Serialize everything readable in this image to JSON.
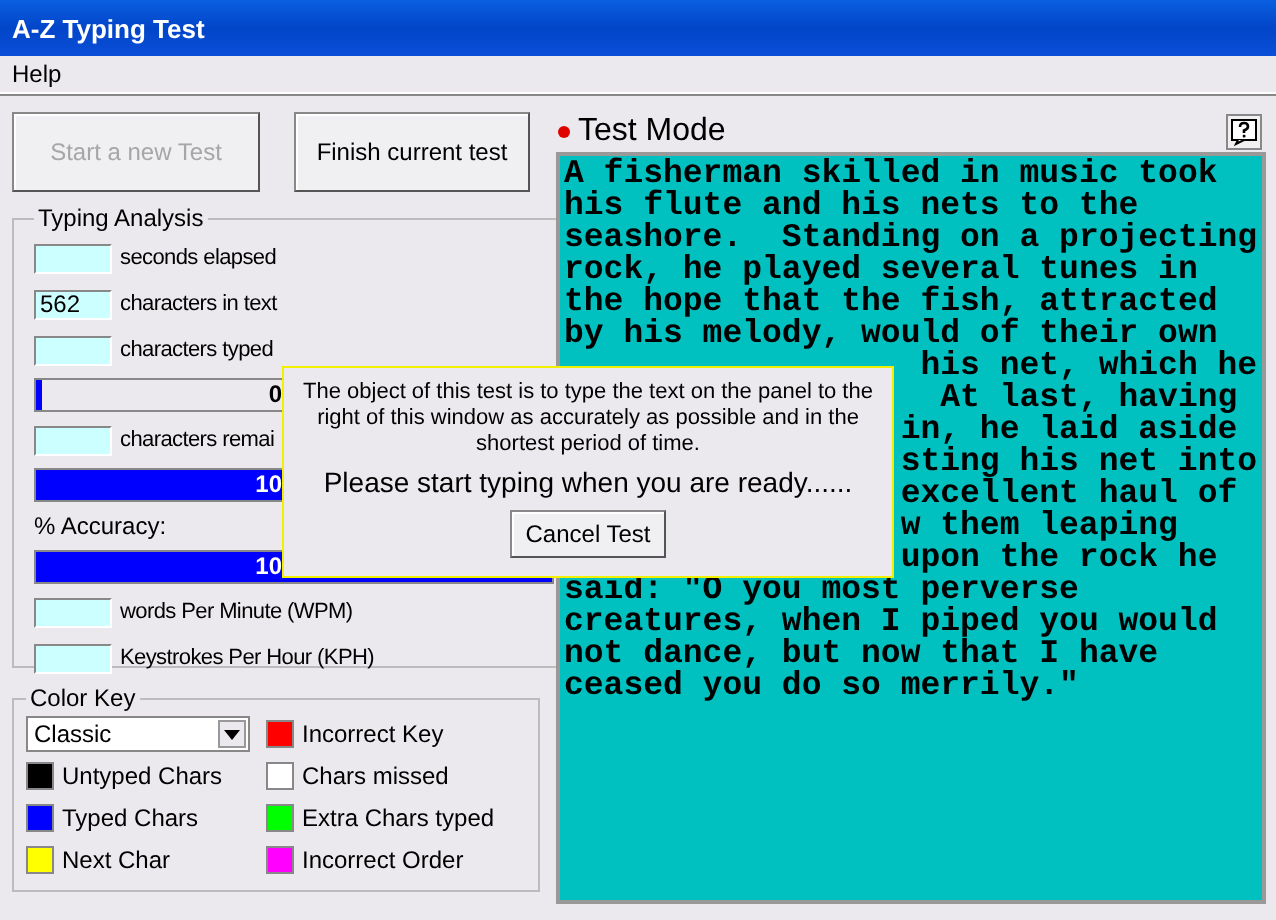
{
  "window": {
    "title": "A-Z Typing Test"
  },
  "menu": [
    {
      "label": "Help"
    }
  ],
  "buttons": [
    {
      "label": "Start a new Test",
      "disabled": true
    },
    {
      "label": "Finish current test",
      "disabled": false
    }
  ],
  "analysis": {
    "title": "Typing Analysis",
    "rows": [
      {
        "kind": "field",
        "label": "seconds elapsed"
      },
      {
        "kind": "field",
        "value": "562",
        "label": "characters in text"
      },
      {
        "kind": "field",
        "label": "characters typed"
      },
      {
        "kind": "bar",
        "level": 0.01,
        "reading": "0"
      },
      {
        "kind": "field",
        "label": "characters remai"
      },
      {
        "kind": "bar",
        "level": 1,
        "reading": "10"
      },
      {
        "kind": "caption",
        "label": "% Accuracy:"
      },
      {
        "kind": "bar",
        "level": 1,
        "reading": "10"
      },
      {
        "kind": "field",
        "label": "words Per Minute (WPM)"
      },
      {
        "kind": "field",
        "label": "Keystrokes Per Hour (KPH)"
      }
    ]
  },
  "color_key": {
    "title": "Color Key",
    "scheme": "Classic",
    "keys": [
      {
        "label": "Incorrect Key",
        "color": "#ff0000"
      },
      {
        "label": "Untyped Chars",
        "color": "#000000"
      },
      {
        "label": "Chars missed",
        "color": "#ffffff"
      },
      {
        "label": "Typed Chars",
        "color": "#0000ff"
      },
      {
        "label": "Extra Chars typed",
        "color": "#00ff00"
      },
      {
        "label": "Next Char",
        "color": "#ffff00"
      },
      {
        "label": "Incorrect Order",
        "color": "#ff00ff"
      }
    ]
  },
  "mode": {
    "label": "Test Mode"
  },
  "passage": {
    "lines": [
      {
        "kind": "full",
        "text": "A fisherman skilled in music took"
      },
      {
        "kind": "full",
        "text": "his flute and his nets to the"
      },
      {
        "kind": "full",
        "text": "seashore.  Standing on a projecting"
      },
      {
        "kind": "full",
        "text": "rock, he played several tunes in"
      },
      {
        "kind": "full",
        "text": "the hope that the fish, attracted"
      },
      {
        "kind": "full",
        "text": "by his melody, would of their own"
      },
      {
        "kind": "partial",
        "text": "his net, which he"
      },
      {
        "kind": "partial",
        "text": "At last, having"
      },
      {
        "kind": "partial",
        "text": "in, he laid aside"
      },
      {
        "kind": "partial",
        "text": "sting his net into"
      },
      {
        "kind": "partial",
        "text": "excellent haul of"
      },
      {
        "kind": "partial",
        "text": "w them leaping"
      },
      {
        "kind": "partial",
        "text": "upon the rock he"
      },
      {
        "kind": "full",
        "text": "said: \"O you most perverse"
      },
      {
        "kind": "full",
        "text": "creatures, when I piped you would"
      },
      {
        "kind": "full",
        "text": "not dance, but now that I have"
      },
      {
        "kind": "full",
        "text": "ceased you do so merrily.\""
      }
    ]
  },
  "dialog": {
    "message": "The object of this test is to type the text on the panel to the right of this window as accurately as possible and in the shortest period of time.",
    "prompt": "Please start typing when you are ready......",
    "button": "Cancel Test"
  }
}
